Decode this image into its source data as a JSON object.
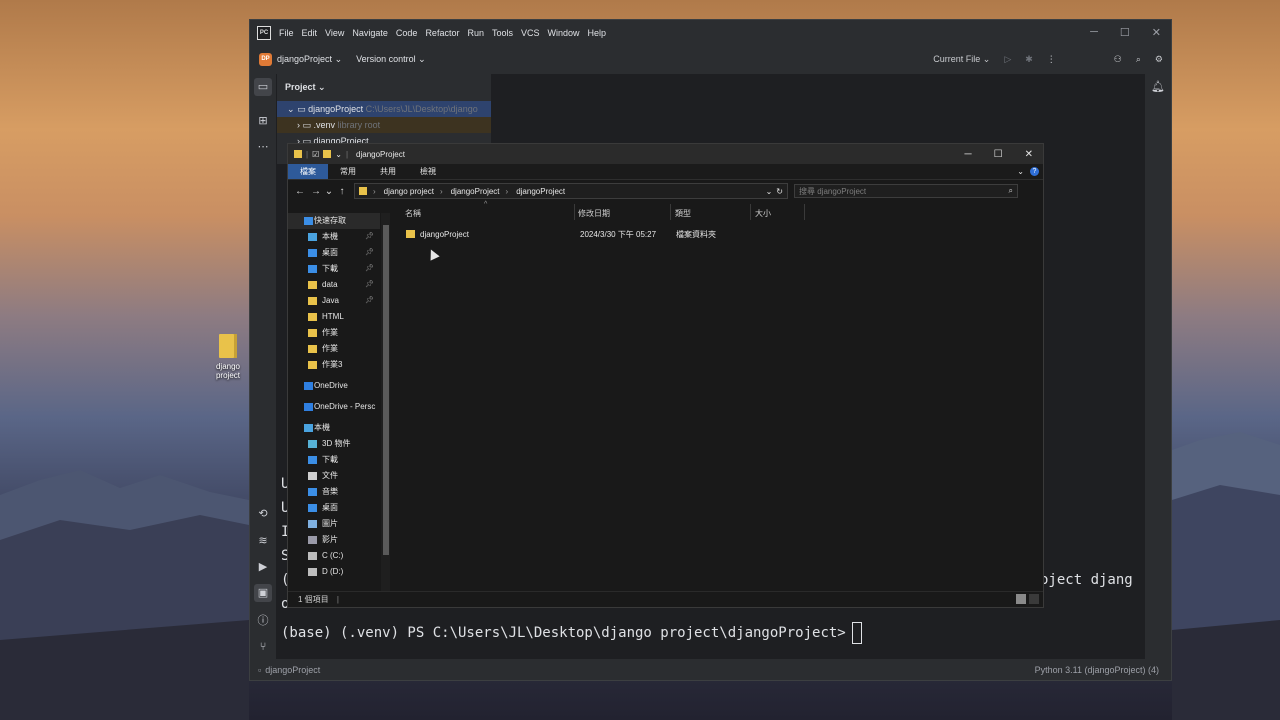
{
  "desktop": {
    "icon_label": "django project"
  },
  "ide": {
    "logo": "PC",
    "menu": [
      "File",
      "Edit",
      "View",
      "Navigate",
      "Code",
      "Refactor",
      "Run",
      "Tools",
      "VCS",
      "Window",
      "Help"
    ],
    "project_badge": "DP",
    "project_name": "djangoProject",
    "version_control": "Version control",
    "run_config": "Current File",
    "panel_title": "Project",
    "tree": {
      "root_name": "djangoProject",
      "root_path": "C:\\Users\\JL\\Desktop\\django",
      "venv_name": ".venv",
      "venv_note": "library root",
      "sub_name": "djangoProject"
    },
    "terminal": {
      "partial_lines": [
        "U",
        "U",
        "I",
        "S",
        "(",
        "o"
      ],
      "right_text": "oject djang",
      "prompt": "(base) (.venv) PS C:\\Users\\JL\\Desktop\\django project\\djangoProject>"
    },
    "status": {
      "left": "djangoProject",
      "right": "Python 3.11 (djangoProject) (4)"
    }
  },
  "explorer": {
    "title": "djangoProject",
    "ribbon_tabs": [
      "檔案",
      "常用",
      "共用",
      "檢視"
    ],
    "breadcrumbs": [
      "django project",
      "djangoProject",
      "djangoProject"
    ],
    "search_placeholder": "搜尋 djangoProject",
    "columns": {
      "name": "名稱",
      "date": "修改日期",
      "type": "類型",
      "size": "大小"
    },
    "files": [
      {
        "name": "djangoProject",
        "date": "2024/3/30 下午 05:27",
        "type": "檔案資料夾",
        "size": ""
      }
    ],
    "nav": [
      {
        "label": "快速存取",
        "icon": "star-icon",
        "pinned": false
      },
      {
        "label": "本機",
        "icon": "computer-icon",
        "pinned": true
      },
      {
        "label": "桌面",
        "icon": "desktop-icon",
        "pinned": true
      },
      {
        "label": "下載",
        "icon": "download-icon",
        "pinned": true
      },
      {
        "label": "data",
        "icon": "folder-icon",
        "pinned": true
      },
      {
        "label": "Java",
        "icon": "folder-icon",
        "pinned": true
      },
      {
        "label": "HTML",
        "icon": "folder-icon",
        "pinned": false
      },
      {
        "label": "作業",
        "icon": "folder-icon",
        "pinned": false
      },
      {
        "label": "作業",
        "icon": "folder-icon",
        "pinned": false
      },
      {
        "label": "作業3",
        "icon": "folder-icon",
        "pinned": false
      },
      {
        "label": "OneDrive",
        "icon": "cloud-icon",
        "pinned": false
      },
      {
        "label": "OneDrive - Persc",
        "icon": "cloud-icon",
        "pinned": false
      },
      {
        "label": "本機",
        "icon": "computer-icon",
        "pinned": false
      },
      {
        "label": "3D 物件",
        "icon": "cube-icon",
        "pinned": false
      },
      {
        "label": "下載",
        "icon": "download-icon",
        "pinned": false
      },
      {
        "label": "文件",
        "icon": "document-icon",
        "pinned": false
      },
      {
        "label": "音樂",
        "icon": "music-icon",
        "pinned": false
      },
      {
        "label": "桌面",
        "icon": "desktop-icon",
        "pinned": false
      },
      {
        "label": "圖片",
        "icon": "picture-icon",
        "pinned": false
      },
      {
        "label": "影片",
        "icon": "video-icon",
        "pinned": false
      },
      {
        "label": "C (C:)",
        "icon": "drive-icon",
        "pinned": false
      },
      {
        "label": "D (D:)",
        "icon": "drive-icon",
        "pinned": false
      }
    ],
    "status_count": "1 個項目"
  }
}
